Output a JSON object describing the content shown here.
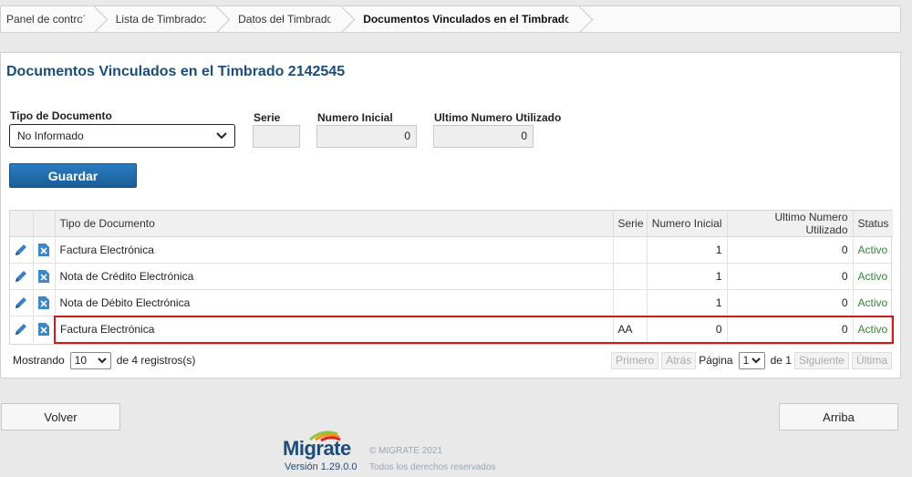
{
  "breadcrumb": [
    {
      "label": "Panel de control"
    },
    {
      "label": "Lista de Timbrados"
    },
    {
      "label": "Datos del Timbrado"
    },
    {
      "label": "Documentos Vinculados en el Timbrado"
    }
  ],
  "page": {
    "title": "Documentos Vinculados en el Timbrado 2142545"
  },
  "form": {
    "tipo_label": "Tipo de Documento",
    "tipo_value": "No Informado",
    "serie_label": "Serie",
    "serie_value": "",
    "numero_inicial_label": "Numero Inicial",
    "numero_inicial_value": "0",
    "ultimo_label": "Ultimo Numero Utilizado",
    "ultimo_value": "0",
    "save_label": "Guardar"
  },
  "table": {
    "headers": {
      "tipo": "Tipo de Documento",
      "serie": "Serie",
      "inicial": "Numero Inicial",
      "ultimo": "Ultimo Numero Utilizado",
      "status": "Status"
    },
    "rows": [
      {
        "tipo": "Factura Electrónica",
        "serie": "",
        "inicial": "1",
        "ultimo": "0",
        "status": "Activo"
      },
      {
        "tipo": "Nota de Crédito Electrónica",
        "serie": "",
        "inicial": "1",
        "ultimo": "0",
        "status": "Activo"
      },
      {
        "tipo": "Nota de Débito Electrónica",
        "serie": "",
        "inicial": "1",
        "ultimo": "0",
        "status": "Activo"
      },
      {
        "tipo": "Factura Electrónica",
        "serie": "AA",
        "inicial": "0",
        "ultimo": "0",
        "status": "Activo"
      }
    ]
  },
  "pager": {
    "showing_label": "Mostrando",
    "page_size": "10",
    "records_text": "de 4 registros(s)",
    "first": "Primero",
    "prev": "Atrás",
    "page_label": "Página",
    "page_value": "1",
    "of_text": "de 1",
    "next": "Siguiente",
    "last": "Última"
  },
  "buttons": {
    "back": "Volver",
    "top": "Arriba"
  },
  "footer": {
    "logo": "Migrate",
    "version": "Versión  1.29.0.0",
    "copyright": "© MIGRATE 2021",
    "rights": "Todos los derechos reservados"
  },
  "colors": {
    "title": "#1a4d7a",
    "save_button": "#1e6aa8",
    "status_active": "#2e8b2e",
    "highlight_border": "#d0191c"
  }
}
